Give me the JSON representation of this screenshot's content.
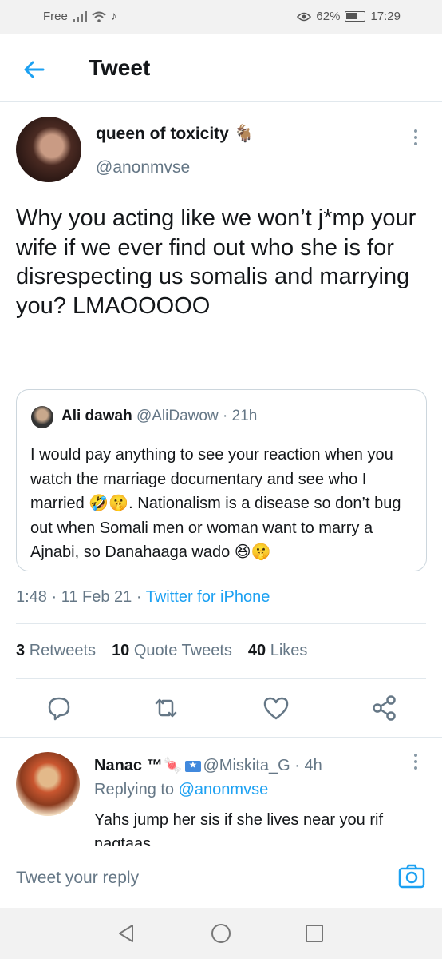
{
  "status_bar": {
    "carrier": "Free",
    "battery": "62%",
    "time": "17:29"
  },
  "header": {
    "title": "Tweet"
  },
  "tweet": {
    "author_name": "queen of toxicity 🐐",
    "author_handle": "@anonmvse",
    "text": "Why you acting like we won’t j*mp your wife if we ever find out who she is for disrespecting us somalis and marrying you? LMAOOOOO",
    "timestamp": "1:48 · 11 Feb 21 · ",
    "client": "Twitter for iPhone"
  },
  "quote": {
    "name": "Ali dawah",
    "handle": "@AliDawow · 21h",
    "text": "I would pay anything to see your reaction when you watch the marriage documentary and see who I married 🤣🤫. Nationalism is a disease so don’t bug out when Somali men or woman want to marry a Ajnabi, so Danahaaga wado 😆🤫"
  },
  "stats": {
    "retweets_count": "3",
    "retweets_label": "Retweets",
    "quotes_count": "10",
    "quotes_label": "Quote Tweets",
    "likes_count": "40",
    "likes_label": "Likes"
  },
  "reply": {
    "name": "Nanac ™🍬",
    "handle": "@Miskita_G · 4h",
    "replying_prefix": "Replying to ",
    "replying_to": "@anonmvse",
    "text": "Yahs jump her sis if she lives near you rif nagtaas"
  },
  "compose": {
    "placeholder": "Tweet your reply"
  },
  "colors": {
    "accent": "#1da1f2",
    "secondary_text": "#657786",
    "divider": "#e1e8ed"
  }
}
